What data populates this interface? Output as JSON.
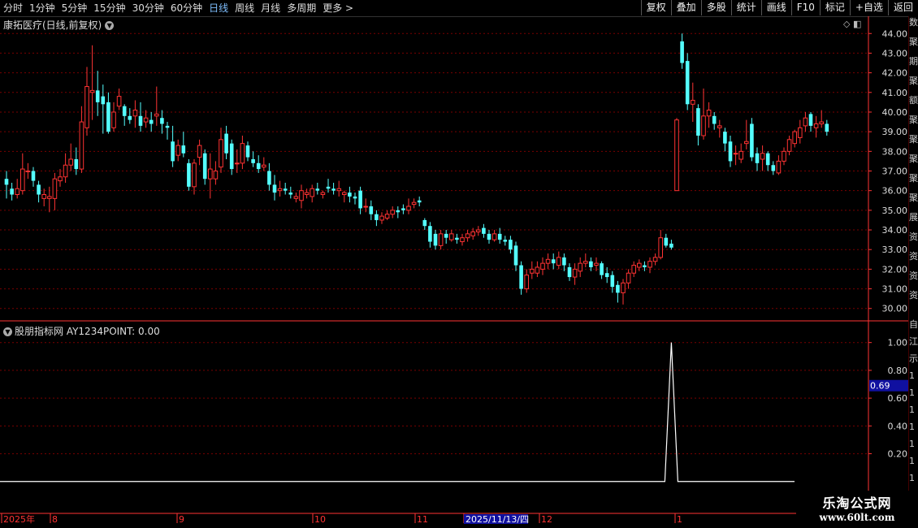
{
  "toolbar": {
    "periods": [
      {
        "label": "分时",
        "active": false
      },
      {
        "label": "1分钟",
        "active": false
      },
      {
        "label": "5分钟",
        "active": false
      },
      {
        "label": "15分钟",
        "active": false
      },
      {
        "label": "30分钟",
        "active": false
      },
      {
        "label": "60分钟",
        "active": false
      },
      {
        "label": "日线",
        "active": true
      },
      {
        "label": "周线",
        "active": false
      },
      {
        "label": "月线",
        "active": false
      },
      {
        "label": "多周期",
        "active": false
      },
      {
        "label": "更多 >",
        "active": false
      }
    ],
    "buttons": [
      "复权",
      "叠加",
      "多股",
      "统计",
      "画线",
      "F10",
      "标记",
      "+自选",
      "返回"
    ]
  },
  "main_title": "康拓医疗(日线,前复权)",
  "indicator_title": "股朋指标网 AY1234POINT: 0.00",
  "indicator_value_box": "0.69",
  "right_strip_chars": [
    "数",
    "聚",
    "期",
    "聚",
    "额",
    "聚",
    "聚",
    "聚",
    "聚",
    "聚",
    "展",
    "资",
    "资",
    "资",
    "资"
  ],
  "right_strip_chars_lower": [
    "自",
    "江",
    "示",
    "1",
    "1",
    "1",
    "1",
    "1",
    "1",
    "1",
    "1"
  ],
  "date_axis": {
    "labels": [
      {
        "text": "2025年",
        "highlight": false
      },
      {
        "text": "8",
        "highlight": false
      },
      {
        "text": "9",
        "highlight": false
      },
      {
        "text": "10",
        "highlight": false
      },
      {
        "text": "11",
        "highlight": false
      },
      {
        "text": "2025/11/13/四",
        "highlight": true
      },
      {
        "text": "12",
        "highlight": false
      },
      {
        "text": "1",
        "highlight": false
      }
    ]
  },
  "watermark": {
    "line1": "乐淘公式网",
    "line2": "www.60lt.com"
  },
  "colors": {
    "up": "#ff3333",
    "down": "#54ffff",
    "grid": "#7a0000",
    "axis": "#ff3333",
    "bg": "#000000",
    "spike": "#ffffff"
  },
  "chart_data": [
    {
      "type": "candlestick",
      "y_ticks": [
        "30.00",
        "31.00",
        "32.00",
        "33.00",
        "34.00",
        "35.00",
        "36.00",
        "37.00",
        "38.00",
        "39.00",
        "40.00",
        "41.00",
        "42.00",
        "43.00",
        "44.00"
      ],
      "ylim": [
        29.7,
        44.3
      ],
      "candles": [
        {
          "o": 36.6,
          "c": 36.3,
          "h": 37.0,
          "l": 35.6
        },
        {
          "o": 36.1,
          "c": 35.8,
          "h": 36.4,
          "l": 35.5
        },
        {
          "o": 35.8,
          "c": 36.1,
          "h": 36.6,
          "l": 35.6
        },
        {
          "o": 36.0,
          "c": 37.1,
          "h": 37.9,
          "l": 35.8
        },
        {
          "o": 37.0,
          "c": 37.0,
          "h": 37.4,
          "l": 36.6
        },
        {
          "o": 37.0,
          "c": 36.5,
          "h": 37.2,
          "l": 36.2
        },
        {
          "o": 36.3,
          "c": 35.8,
          "h": 36.5,
          "l": 35.4
        },
        {
          "o": 35.6,
          "c": 35.8,
          "h": 36.1,
          "l": 35.2
        },
        {
          "o": 35.6,
          "c": 35.7,
          "h": 36.2,
          "l": 34.9
        },
        {
          "o": 35.6,
          "c": 36.6,
          "h": 36.9,
          "l": 35.0
        },
        {
          "o": 36.5,
          "c": 36.7,
          "h": 37.1,
          "l": 36.2
        },
        {
          "o": 36.7,
          "c": 37.3,
          "h": 37.9,
          "l": 36.4
        },
        {
          "o": 37.3,
          "c": 37.6,
          "h": 38.4,
          "l": 37.0
        },
        {
          "o": 37.6,
          "c": 37.1,
          "h": 38.2,
          "l": 36.8
        },
        {
          "o": 37.1,
          "c": 39.5,
          "h": 40.3,
          "l": 36.9
        },
        {
          "o": 39.2,
          "c": 41.3,
          "h": 42.3,
          "l": 38.8
        },
        {
          "o": 41.0,
          "c": 41.1,
          "h": 43.4,
          "l": 39.6
        },
        {
          "o": 41.1,
          "c": 40.5,
          "h": 42.1,
          "l": 39.8
        },
        {
          "o": 40.8,
          "c": 40.4,
          "h": 41.4,
          "l": 38.9
        },
        {
          "o": 40.5,
          "c": 39.0,
          "h": 41.0,
          "l": 38.9
        },
        {
          "o": 39.2,
          "c": 40.0,
          "h": 40.5,
          "l": 39.0
        },
        {
          "o": 40.3,
          "c": 40.8,
          "h": 41.2,
          "l": 40.1
        },
        {
          "o": 40.3,
          "c": 39.8,
          "h": 40.4,
          "l": 39.3
        },
        {
          "o": 39.8,
          "c": 39.6,
          "h": 40.2,
          "l": 39.4
        },
        {
          "o": 39.8,
          "c": 40.1,
          "h": 40.6,
          "l": 39.2
        },
        {
          "o": 39.8,
          "c": 39.3,
          "h": 40.5,
          "l": 39.0
        },
        {
          "o": 39.5,
          "c": 39.7,
          "h": 40.1,
          "l": 39.2
        },
        {
          "o": 39.6,
          "c": 39.4,
          "h": 40.0,
          "l": 39.0
        },
        {
          "o": 39.8,
          "c": 39.9,
          "h": 41.3,
          "l": 39.3
        },
        {
          "o": 39.7,
          "c": 39.4,
          "h": 40.1,
          "l": 38.9
        },
        {
          "o": 39.3,
          "c": 39.2,
          "h": 39.5,
          "l": 38.6
        },
        {
          "o": 38.5,
          "c": 37.5,
          "h": 39.3,
          "l": 37.2
        },
        {
          "o": 37.8,
          "c": 38.3,
          "h": 38.6,
          "l": 37.5
        },
        {
          "o": 38.3,
          "c": 37.9,
          "h": 39.0,
          "l": 37.7
        },
        {
          "o": 37.4,
          "c": 36.2,
          "h": 37.6,
          "l": 36.0
        },
        {
          "o": 36.2,
          "c": 37.4,
          "h": 37.6,
          "l": 35.8
        },
        {
          "o": 37.7,
          "c": 38.3,
          "h": 38.6,
          "l": 37.3
        },
        {
          "o": 37.9,
          "c": 36.6,
          "h": 38.1,
          "l": 36.3
        },
        {
          "o": 36.6,
          "c": 37.1,
          "h": 37.9,
          "l": 35.6
        },
        {
          "o": 36.6,
          "c": 37.0,
          "h": 37.5,
          "l": 36.3
        },
        {
          "o": 37.2,
          "c": 38.6,
          "h": 39.2,
          "l": 36.9
        },
        {
          "o": 38.9,
          "c": 37.9,
          "h": 39.3,
          "l": 37.6
        },
        {
          "o": 38.4,
          "c": 37.1,
          "h": 38.6,
          "l": 36.8
        },
        {
          "o": 37.4,
          "c": 37.4,
          "h": 38.1,
          "l": 36.9
        },
        {
          "o": 37.4,
          "c": 38.4,
          "h": 38.8,
          "l": 37.1
        },
        {
          "o": 38.3,
          "c": 37.7,
          "h": 38.5,
          "l": 37.5
        },
        {
          "o": 37.6,
          "c": 37.4,
          "h": 38.0,
          "l": 37.2
        },
        {
          "o": 37.4,
          "c": 37.1,
          "h": 37.8,
          "l": 36.9
        },
        {
          "o": 37.2,
          "c": 37.3,
          "h": 37.7,
          "l": 37.0
        },
        {
          "o": 37.0,
          "c": 36.3,
          "h": 37.4,
          "l": 36.0
        },
        {
          "o": 36.3,
          "c": 35.9,
          "h": 36.8,
          "l": 35.5
        },
        {
          "o": 36.0,
          "c": 36.1,
          "h": 36.5,
          "l": 35.7
        },
        {
          "o": 36.1,
          "c": 36.0,
          "h": 36.4,
          "l": 35.8
        },
        {
          "o": 35.9,
          "c": 35.8,
          "h": 36.2,
          "l": 35.6
        },
        {
          "o": 35.6,
          "c": 35.7,
          "h": 35.9,
          "l": 35.4
        },
        {
          "o": 35.5,
          "c": 36.0,
          "h": 36.3,
          "l": 35.1
        },
        {
          "o": 35.8,
          "c": 35.9,
          "h": 36.1,
          "l": 35.6
        },
        {
          "o": 35.7,
          "c": 36.1,
          "h": 36.3,
          "l": 35.4
        },
        {
          "o": 36.1,
          "c": 36.0,
          "h": 36.4,
          "l": 35.8
        },
        {
          "o": 35.8,
          "c": 35.9,
          "h": 36.0,
          "l": 35.6
        },
        {
          "o": 36.2,
          "c": 36.1,
          "h": 36.6,
          "l": 35.9
        },
        {
          "o": 36.1,
          "c": 36.0,
          "h": 36.4,
          "l": 35.8
        },
        {
          "o": 36.0,
          "c": 36.1,
          "h": 36.5,
          "l": 35.7
        },
        {
          "o": 35.8,
          "c": 35.9,
          "h": 36.0,
          "l": 35.4
        },
        {
          "o": 35.9,
          "c": 35.7,
          "h": 36.2,
          "l": 35.4
        },
        {
          "o": 35.7,
          "c": 35.6,
          "h": 35.9,
          "l": 35.3
        },
        {
          "o": 36.0,
          "c": 35.1,
          "h": 36.2,
          "l": 34.8
        },
        {
          "o": 35.2,
          "c": 35.2,
          "h": 35.6,
          "l": 34.9
        },
        {
          "o": 35.2,
          "c": 34.8,
          "h": 35.5,
          "l": 34.5
        },
        {
          "o": 34.8,
          "c": 34.5,
          "h": 35.0,
          "l": 34.2
        },
        {
          "o": 34.5,
          "c": 34.7,
          "h": 34.9,
          "l": 34.3
        },
        {
          "o": 34.6,
          "c": 34.8,
          "h": 35.0,
          "l": 34.5
        },
        {
          "o": 34.8,
          "c": 35.0,
          "h": 35.2,
          "l": 34.6
        },
        {
          "o": 35.0,
          "c": 34.9,
          "h": 35.2,
          "l": 34.6
        },
        {
          "o": 35.1,
          "c": 35.0,
          "h": 35.3,
          "l": 34.8
        },
        {
          "o": 35.0,
          "c": 35.2,
          "h": 35.6,
          "l": 34.8
        },
        {
          "o": 35.3,
          "c": 35.4,
          "h": 35.6,
          "l": 35.1
        },
        {
          "o": 35.5,
          "c": 35.4,
          "h": 35.7,
          "l": 35.2
        },
        {
          "o": 34.5,
          "c": 34.2,
          "h": 34.6,
          "l": 34.0
        },
        {
          "o": 34.2,
          "c": 33.4,
          "h": 34.4,
          "l": 33.1
        },
        {
          "o": 33.8,
          "c": 33.2,
          "h": 34.0,
          "l": 33.0
        },
        {
          "o": 33.2,
          "c": 33.8,
          "h": 34.0,
          "l": 33.0
        },
        {
          "o": 33.8,
          "c": 33.6,
          "h": 34.0,
          "l": 33.3
        },
        {
          "o": 33.5,
          "c": 33.8,
          "h": 34.0,
          "l": 33.4
        },
        {
          "o": 33.6,
          "c": 33.5,
          "h": 33.8,
          "l": 33.3
        },
        {
          "o": 33.4,
          "c": 33.6,
          "h": 33.8,
          "l": 33.2
        },
        {
          "o": 33.6,
          "c": 33.8,
          "h": 34.0,
          "l": 33.4
        },
        {
          "o": 33.7,
          "c": 33.9,
          "h": 34.1,
          "l": 33.5
        },
        {
          "o": 33.9,
          "c": 34.0,
          "h": 34.2,
          "l": 33.7
        },
        {
          "o": 34.1,
          "c": 33.8,
          "h": 34.3,
          "l": 33.6
        },
        {
          "o": 33.8,
          "c": 33.5,
          "h": 34.0,
          "l": 33.3
        },
        {
          "o": 33.5,
          "c": 33.8,
          "h": 34.0,
          "l": 33.4
        },
        {
          "o": 33.8,
          "c": 33.5,
          "h": 34.1,
          "l": 33.3
        },
        {
          "o": 33.5,
          "c": 33.4,
          "h": 33.7,
          "l": 33.2
        },
        {
          "o": 33.5,
          "c": 33.0,
          "h": 33.7,
          "l": 32.8
        },
        {
          "o": 33.2,
          "c": 32.2,
          "h": 33.4,
          "l": 31.9
        },
        {
          "o": 32.2,
          "c": 31.0,
          "h": 32.4,
          "l": 30.7
        },
        {
          "o": 31.0,
          "c": 31.7,
          "h": 32.0,
          "l": 30.8
        },
        {
          "o": 31.8,
          "c": 32.0,
          "h": 32.4,
          "l": 31.5
        },
        {
          "o": 31.8,
          "c": 32.1,
          "h": 32.4,
          "l": 31.6
        },
        {
          "o": 32.0,
          "c": 32.3,
          "h": 32.6,
          "l": 31.7
        },
        {
          "o": 32.3,
          "c": 32.5,
          "h": 32.8,
          "l": 32.0
        },
        {
          "o": 32.5,
          "c": 32.3,
          "h": 32.8,
          "l": 32.0
        },
        {
          "o": 32.2,
          "c": 32.6,
          "h": 32.9,
          "l": 32.0
        },
        {
          "o": 32.6,
          "c": 32.2,
          "h": 32.8,
          "l": 31.9
        },
        {
          "o": 32.1,
          "c": 31.6,
          "h": 32.3,
          "l": 31.4
        },
        {
          "o": 31.6,
          "c": 32.0,
          "h": 32.3,
          "l": 31.2
        },
        {
          "o": 31.9,
          "c": 32.3,
          "h": 32.6,
          "l": 31.6
        },
        {
          "o": 32.3,
          "c": 32.4,
          "h": 32.8,
          "l": 32.1
        },
        {
          "o": 32.4,
          "c": 32.1,
          "h": 32.6,
          "l": 31.9
        },
        {
          "o": 32.2,
          "c": 32.3,
          "h": 32.6,
          "l": 31.9
        },
        {
          "o": 32.3,
          "c": 31.7,
          "h": 32.4,
          "l": 31.5
        },
        {
          "o": 31.8,
          "c": 31.6,
          "h": 32.1,
          "l": 31.3
        },
        {
          "o": 31.7,
          "c": 31.1,
          "h": 31.9,
          "l": 30.8
        },
        {
          "o": 31.2,
          "c": 30.8,
          "h": 31.4,
          "l": 30.3
        },
        {
          "o": 30.8,
          "c": 31.3,
          "h": 31.5,
          "l": 30.2
        },
        {
          "o": 31.3,
          "c": 31.8,
          "h": 32.0,
          "l": 31.0
        },
        {
          "o": 31.8,
          "c": 32.2,
          "h": 32.4,
          "l": 31.6
        },
        {
          "o": 32.1,
          "c": 32.3,
          "h": 32.5,
          "l": 31.9
        },
        {
          "o": 32.2,
          "c": 32.1,
          "h": 32.4,
          "l": 31.9
        },
        {
          "o": 32.1,
          "c": 32.4,
          "h": 32.6,
          "l": 31.8
        },
        {
          "o": 32.4,
          "c": 32.6,
          "h": 32.8,
          "l": 32.2
        },
        {
          "o": 32.6,
          "c": 33.6,
          "h": 34.0,
          "l": 32.5
        },
        {
          "o": 33.6,
          "c": 33.2,
          "h": 33.8,
          "l": 33.1
        },
        {
          "o": 33.3,
          "c": 33.1,
          "h": 33.5,
          "l": 33.0
        },
        {
          "o": 36.0,
          "c": 39.6,
          "h": 39.7,
          "l": 36.0
        },
        {
          "o": 43.6,
          "c": 42.5,
          "h": 44.0,
          "l": 42.2
        },
        {
          "o": 42.6,
          "c": 40.4,
          "h": 43.0,
          "l": 40.1
        },
        {
          "o": 40.4,
          "c": 40.6,
          "h": 41.5,
          "l": 39.5
        },
        {
          "o": 40.2,
          "c": 38.8,
          "h": 40.4,
          "l": 38.3
        },
        {
          "o": 38.8,
          "c": 39.8,
          "h": 41.2,
          "l": 38.6
        },
        {
          "o": 39.8,
          "c": 40.1,
          "h": 40.5,
          "l": 39.2
        },
        {
          "o": 39.8,
          "c": 39.4,
          "h": 40.0,
          "l": 39.1
        },
        {
          "o": 39.2,
          "c": 39.3,
          "h": 39.6,
          "l": 38.7
        },
        {
          "o": 39.0,
          "c": 38.4,
          "h": 39.2,
          "l": 38.0
        },
        {
          "o": 38.5,
          "c": 37.5,
          "h": 38.8,
          "l": 37.2
        },
        {
          "o": 37.9,
          "c": 37.9,
          "h": 38.3,
          "l": 37.3
        },
        {
          "o": 37.6,
          "c": 38.0,
          "h": 38.4,
          "l": 37.4
        },
        {
          "o": 38.4,
          "c": 38.5,
          "h": 39.6,
          "l": 38.1
        },
        {
          "o": 39.4,
          "c": 37.7,
          "h": 39.7,
          "l": 37.5
        },
        {
          "o": 37.9,
          "c": 37.4,
          "h": 38.2,
          "l": 37.0
        },
        {
          "o": 37.6,
          "c": 37.9,
          "h": 38.3,
          "l": 37.0
        },
        {
          "o": 37.9,
          "c": 37.3,
          "h": 38.0,
          "l": 37.0
        },
        {
          "o": 37.3,
          "c": 37.0,
          "h": 37.5,
          "l": 36.8
        },
        {
          "o": 36.9,
          "c": 37.5,
          "h": 37.8,
          "l": 36.8
        },
        {
          "o": 37.5,
          "c": 38.0,
          "h": 38.2,
          "l": 37.3
        },
        {
          "o": 38.0,
          "c": 38.6,
          "h": 38.8,
          "l": 37.8
        },
        {
          "o": 38.4,
          "c": 39.0,
          "h": 39.1,
          "l": 38.2
        },
        {
          "o": 38.7,
          "c": 39.2,
          "h": 39.6,
          "l": 38.4
        },
        {
          "o": 39.3,
          "c": 39.7,
          "h": 40.0,
          "l": 39.0
        },
        {
          "o": 39.9,
          "c": 39.3,
          "h": 40.0,
          "l": 39.0
        },
        {
          "o": 39.2,
          "c": 39.4,
          "h": 39.8,
          "l": 38.7
        },
        {
          "o": 39.4,
          "c": 39.5,
          "h": 40.1,
          "l": 39.2
        },
        {
          "o": 39.4,
          "c": 39.0,
          "h": 39.6,
          "l": 38.8
        }
      ]
    },
    {
      "type": "line",
      "series": [
        {
          "name": "AY1234POINT",
          "spike_index": 124,
          "peak": 1.0
        }
      ],
      "y_ticks": [
        "0.20",
        "0.40",
        "0.60",
        "0.80",
        "1.00"
      ],
      "ylim": [
        -0.2,
        1.08
      ]
    }
  ]
}
